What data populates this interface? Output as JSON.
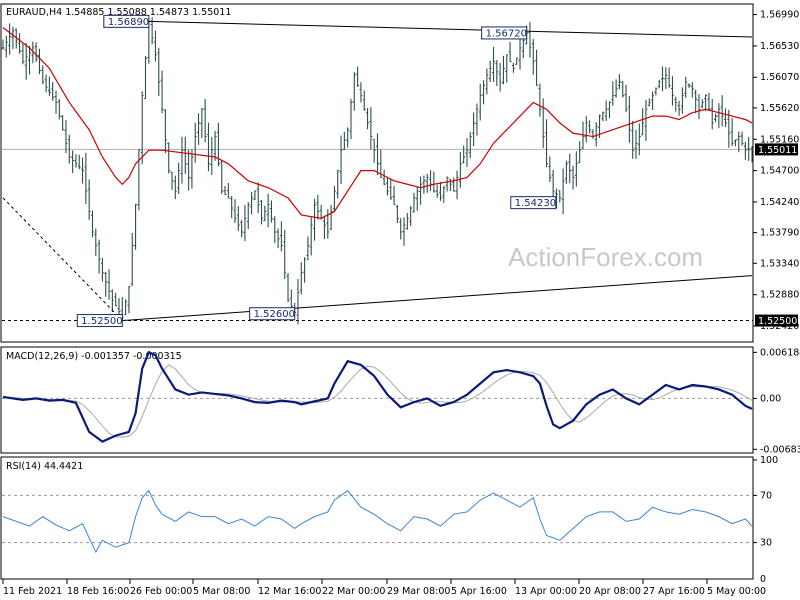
{
  "chart_data": [
    {
      "type": "candlestick",
      "title": "EURAUD,H4",
      "ohlc_header": "1.54885 1.55088 1.54873 1.55011",
      "ylim": [
        1.522,
        1.5713
      ],
      "y_ticks": [
        "1.56990",
        "1.56530",
        "1.56070",
        "1.55620",
        "1.55160",
        "1.54700",
        "1.54240",
        "1.53790",
        "1.53340",
        "1.52880",
        "1.52420"
      ],
      "current_price": "1.55011",
      "level_price": "1.52500",
      "x_ticks": [
        "11 Feb 2021",
        "18 Feb 16:00",
        "26 Feb 00:00",
        "5 Mar 08:00",
        "12 Mar 16:00",
        "22 Mar 00:00",
        "29 Mar 08:00",
        "5 Apr 16:00",
        "13 Apr 00:00",
        "20 Apr 08:00",
        "27 Apr 16:00",
        "5 May 00:00"
      ],
      "annotations": [
        "1.56890",
        "1.56720",
        "1.54230",
        "1.52500",
        "1.52600"
      ],
      "price_path": [
        [
          0,
          1.565
        ],
        [
          3,
          1.5675
        ],
        [
          6,
          1.563
        ],
        [
          9,
          1.565
        ],
        [
          12,
          1.56
        ],
        [
          16,
          1.557
        ],
        [
          20,
          1.549
        ],
        [
          24,
          1.547
        ],
        [
          27,
          1.538
        ],
        [
          30,
          1.532
        ],
        [
          33,
          1.528
        ],
        [
          36,
          1.5255
        ],
        [
          38,
          1.53
        ],
        [
          40,
          1.542
        ],
        [
          42,
          1.558
        ],
        [
          44,
          1.5689
        ],
        [
          46,
          1.564
        ],
        [
          48,
          1.556
        ],
        [
          50,
          1.547
        ],
        [
          52,
          1.544
        ],
        [
          54,
          1.55
        ],
        [
          56,
          1.546
        ],
        [
          58,
          1.552
        ],
        [
          60,
          1.556
        ],
        [
          62,
          1.548
        ],
        [
          64,
          1.552
        ],
        [
          66,
          1.544
        ],
        [
          68,
          1.543
        ],
        [
          70,
          1.54
        ],
        [
          72,
          1.538
        ],
        [
          74,
          1.542
        ],
        [
          76,
          1.544
        ],
        [
          78,
          1.54
        ],
        [
          80,
          1.542
        ],
        [
          82,
          1.538
        ],
        [
          84,
          1.536
        ],
        [
          86,
          1.528
        ],
        [
          88,
          1.5262
        ],
        [
          90,
          1.532
        ],
        [
          92,
          1.536
        ],
        [
          94,
          1.542
        ],
        [
          96,
          1.54
        ],
        [
          98,
          1.538
        ],
        [
          100,
          1.544
        ],
        [
          102,
          1.55
        ],
        [
          104,
          1.553
        ],
        [
          106,
          1.561
        ],
        [
          108,
          1.558
        ],
        [
          110,
          1.554
        ],
        [
          112,
          1.55
        ],
        [
          114,
          1.546
        ],
        [
          116,
          1.544
        ],
        [
          118,
          1.542
        ],
        [
          120,
          1.538
        ],
        [
          122,
          1.54
        ],
        [
          124,
          1.543
        ],
        [
          126,
          1.545
        ],
        [
          128,
          1.546
        ],
        [
          130,
          1.544
        ],
        [
          132,
          1.543
        ],
        [
          134,
          1.546
        ],
        [
          136,
          1.544
        ],
        [
          138,
          1.548
        ],
        [
          140,
          1.55
        ],
        [
          142,
          1.554
        ],
        [
          144,
          1.558
        ],
        [
          146,
          1.561
        ],
        [
          148,
          1.563
        ],
        [
          150,
          1.56
        ],
        [
          152,
          1.564
        ],
        [
          154,
          1.562
        ],
        [
          156,
          1.565
        ],
        [
          158,
          1.5672
        ],
        [
          160,
          1.563
        ],
        [
          162,
          1.556
        ],
        [
          164,
          1.548
        ],
        [
          166,
          1.544
        ],
        [
          168,
          1.543
        ],
        [
          170,
          1.548
        ],
        [
          172,
          1.546
        ],
        [
          174,
          1.55
        ],
        [
          176,
          1.554
        ],
        [
          178,
          1.552
        ],
        [
          180,
          1.555
        ],
        [
          182,
          1.556
        ],
        [
          184,
          1.558
        ],
        [
          186,
          1.56
        ],
        [
          188,
          1.556
        ],
        [
          190,
          1.55
        ],
        [
          192,
          1.552
        ],
        [
          194,
          1.556
        ],
        [
          196,
          1.558
        ],
        [
          198,
          1.56
        ],
        [
          200,
          1.561
        ],
        [
          202,
          1.558
        ],
        [
          204,
          1.556
        ],
        [
          206,
          1.56
        ],
        [
          208,
          1.559
        ],
        [
          210,
          1.556
        ],
        [
          212,
          1.558
        ],
        [
          214,
          1.554
        ],
        [
          216,
          1.556
        ],
        [
          218,
          1.554
        ],
        [
          220,
          1.551
        ],
        [
          222,
          1.552
        ],
        [
          224,
          1.55
        ],
        [
          226,
          1.5501
        ]
      ],
      "series": [
        {
          "name": "",
          "type": "ma",
          "color": "#cc0000",
          "values": [
            [
              0,
              1.568
            ],
            [
              8,
              1.565
            ],
            [
              14,
              1.562
            ],
            [
              20,
              1.557
            ],
            [
              26,
              1.553
            ],
            [
              30,
              1.549
            ],
            [
              34,
              1.546
            ],
            [
              36,
              1.545
            ],
            [
              38,
              1.546
            ],
            [
              40,
              1.548
            ],
            [
              44,
              1.55
            ],
            [
              48,
              1.55
            ],
            [
              56,
              1.5495
            ],
            [
              64,
              1.549
            ],
            [
              68,
              1.548
            ],
            [
              74,
              1.5455
            ],
            [
              80,
              1.5445
            ],
            [
              86,
              1.543
            ],
            [
              90,
              1.5405
            ],
            [
              96,
              1.54
            ],
            [
              100,
              1.541
            ],
            [
              104,
              1.544
            ],
            [
              108,
              1.547
            ],
            [
              112,
              1.547
            ],
            [
              118,
              1.5455
            ],
            [
              122,
              1.545
            ],
            [
              126,
              1.5445
            ],
            [
              130,
              1.545
            ],
            [
              136,
              1.5455
            ],
            [
              140,
              1.546
            ],
            [
              144,
              1.548
            ],
            [
              148,
              1.551
            ],
            [
              152,
              1.553
            ],
            [
              156,
              1.555
            ],
            [
              160,
              1.557
            ],
            [
              164,
              1.556
            ],
            [
              168,
              1.554
            ],
            [
              172,
              1.5525
            ],
            [
              178,
              1.552
            ],
            [
              184,
              1.553
            ],
            [
              190,
              1.554
            ],
            [
              196,
              1.555
            ],
            [
              200,
              1.555
            ],
            [
              204,
              1.5545
            ],
            [
              208,
              1.5555
            ],
            [
              212,
              1.556
            ],
            [
              216,
              1.5555
            ],
            [
              220,
              1.555
            ],
            [
              224,
              1.5545
            ],
            [
              226,
              1.554
            ]
          ]
        }
      ]
    },
    {
      "type": "line",
      "title": "MACD(12,26,9) -0.001357 -0.000315",
      "ylim": [
        -0.0072,
        0.0065
      ],
      "y_ticks": [
        "0.006184",
        "0.00",
        "-0.006837"
      ],
      "series": [
        {
          "name": "",
          "color": "#0a1a7a",
          "values": [
            [
              0,
              0.0002
            ],
            [
              6,
              -0.0002
            ],
            [
              10,
              0.0
            ],
            [
              14,
              -0.0003
            ],
            [
              18,
              -0.0002
            ],
            [
              22,
              -0.0006
            ],
            [
              26,
              -0.0045
            ],
            [
              30,
              -0.0058
            ],
            [
              34,
              -0.005
            ],
            [
              38,
              -0.0045
            ],
            [
              40,
              -0.002
            ],
            [
              42,
              0.004
            ],
            [
              44,
              0.0062
            ],
            [
              46,
              0.0058
            ],
            [
              48,
              0.004
            ],
            [
              52,
              0.0012
            ],
            [
              56,
              0.0005
            ],
            [
              60,
              0.0008
            ],
            [
              64,
              0.0006
            ],
            [
              68,
              0.0004
            ],
            [
              72,
              0.0
            ],
            [
              76,
              -0.0005
            ],
            [
              80,
              -0.0006
            ],
            [
              84,
              -0.0003
            ],
            [
              88,
              -0.0005
            ],
            [
              90,
              -0.0008
            ],
            [
              94,
              -0.0004
            ],
            [
              98,
              0.0
            ],
            [
              100,
              0.002
            ],
            [
              104,
              0.005
            ],
            [
              108,
              0.0045
            ],
            [
              112,
              0.003
            ],
            [
              116,
              0.0005
            ],
            [
              120,
              -0.0012
            ],
            [
              124,
              -0.0005
            ],
            [
              128,
              0.0
            ],
            [
              132,
              -0.001
            ],
            [
              136,
              -0.0005
            ],
            [
              140,
              0.0005
            ],
            [
              144,
              0.002
            ],
            [
              148,
              0.0035
            ],
            [
              152,
              0.0038
            ],
            [
              156,
              0.0035
            ],
            [
              160,
              0.003
            ],
            [
              162,
              0.002
            ],
            [
              164,
              -0.001
            ],
            [
              166,
              -0.0035
            ],
            [
              168,
              -0.004
            ],
            [
              172,
              -0.003
            ],
            [
              176,
              -0.0008
            ],
            [
              180,
              0.0005
            ],
            [
              184,
              0.0012
            ],
            [
              188,
              0.0
            ],
            [
              192,
              -0.0008
            ],
            [
              196,
              0.0005
            ],
            [
              200,
              0.0018
            ],
            [
              204,
              0.0012
            ],
            [
              208,
              0.0018
            ],
            [
              212,
              0.0016
            ],
            [
              216,
              0.0012
            ],
            [
              220,
              0.0005
            ],
            [
              224,
              -0.001
            ],
            [
              226,
              -0.0014
            ]
          ]
        }
      ]
    },
    {
      "type": "line",
      "title": "RSI(14) 44.4421",
      "ylim": [
        0,
        100
      ],
      "y_ticks": [
        "100",
        "70",
        "30",
        "0"
      ],
      "levels": [
        70,
        30
      ],
      "series": [
        {
          "name": "",
          "color": "#3a86d8",
          "values": [
            [
              0,
              52
            ],
            [
              4,
              48
            ],
            [
              8,
              44
            ],
            [
              12,
              52
            ],
            [
              16,
              45
            ],
            [
              20,
              40
            ],
            [
              24,
              46
            ],
            [
              26,
              34
            ],
            [
              28,
              22
            ],
            [
              30,
              32
            ],
            [
              34,
              26
            ],
            [
              38,
              30
            ],
            [
              40,
              52
            ],
            [
              42,
              68
            ],
            [
              44,
              74
            ],
            [
              46,
              62
            ],
            [
              48,
              54
            ],
            [
              52,
              48
            ],
            [
              56,
              56
            ],
            [
              60,
              52
            ],
            [
              64,
              52
            ],
            [
              68,
              46
            ],
            [
              72,
              50
            ],
            [
              76,
              44
            ],
            [
              80,
              52
            ],
            [
              84,
              50
            ],
            [
              88,
              42
            ],
            [
              90,
              46
            ],
            [
              94,
              52
            ],
            [
              98,
              56
            ],
            [
              100,
              66
            ],
            [
              104,
              74
            ],
            [
              108,
              60
            ],
            [
              112,
              54
            ],
            [
              116,
              46
            ],
            [
              120,
              40
            ],
            [
              124,
              52
            ],
            [
              128,
              50
            ],
            [
              132,
              44
            ],
            [
              136,
              54
            ],
            [
              140,
              56
            ],
            [
              144,
              66
            ],
            [
              148,
              72
            ],
            [
              152,
              66
            ],
            [
              156,
              60
            ],
            [
              160,
              68
            ],
            [
              162,
              50
            ],
            [
              164,
              36
            ],
            [
              168,
              32
            ],
            [
              172,
              42
            ],
            [
              176,
              52
            ],
            [
              180,
              56
            ],
            [
              184,
              56
            ],
            [
              188,
              48
            ],
            [
              192,
              50
            ],
            [
              196,
              60
            ],
            [
              200,
              56
            ],
            [
              204,
              54
            ],
            [
              208,
              58
            ],
            [
              212,
              56
            ],
            [
              216,
              52
            ],
            [
              220,
              46
            ],
            [
              224,
              50
            ],
            [
              226,
              44
            ]
          ]
        }
      ]
    }
  ],
  "watermark": "ActionForex.com"
}
